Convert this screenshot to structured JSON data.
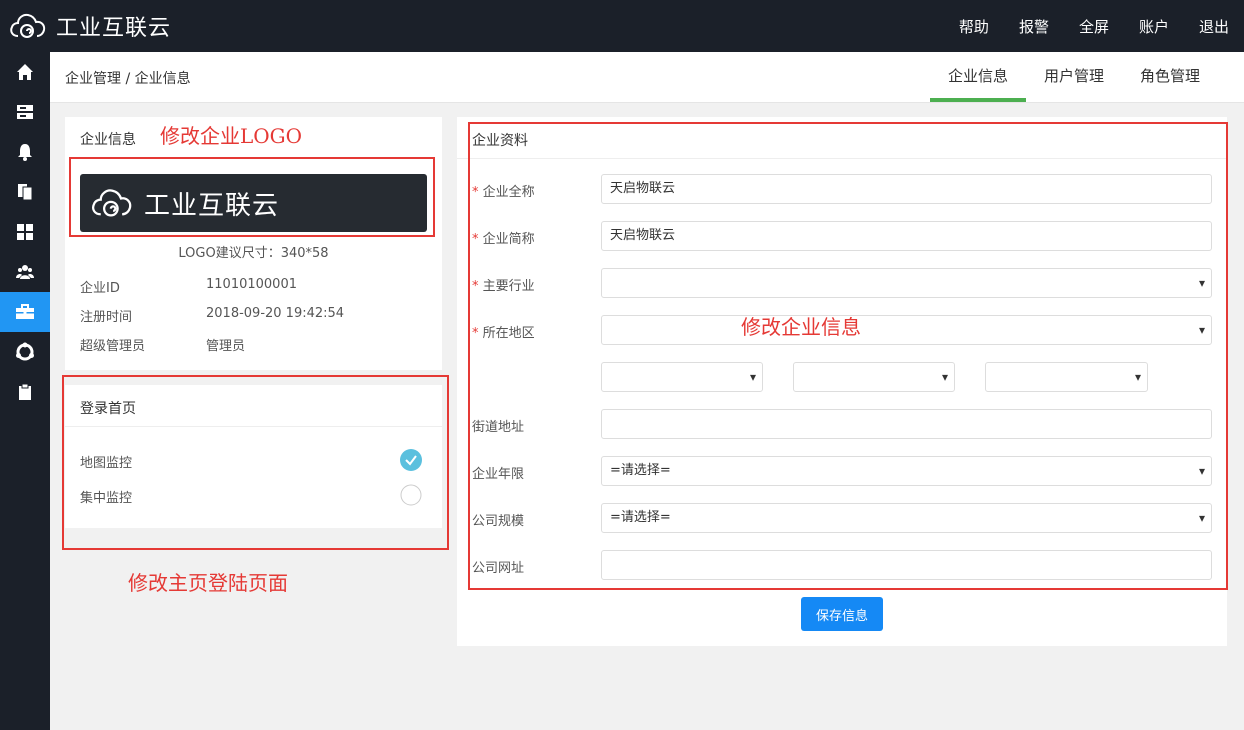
{
  "app": {
    "title": "工业互联云"
  },
  "topnav": [
    {
      "label": "帮助"
    },
    {
      "label": "报警"
    },
    {
      "label": "全屏"
    },
    {
      "label": "账户"
    },
    {
      "label": "退出"
    }
  ],
  "sidebar": [
    {
      "icon": "home-icon"
    },
    {
      "icon": "server-icon"
    },
    {
      "icon": "bell-icon"
    },
    {
      "icon": "copy-icon"
    },
    {
      "icon": "grid-icon"
    },
    {
      "icon": "users-icon"
    },
    {
      "icon": "briefcase-icon",
      "active": true
    },
    {
      "icon": "shield-icon"
    },
    {
      "icon": "clipboard-icon"
    }
  ],
  "breadcrumb": "企业管理 / 企业信息",
  "tabs": [
    {
      "label": "企业信息",
      "active": true
    },
    {
      "label": "用户管理"
    },
    {
      "label": "角色管理"
    }
  ],
  "company_card": {
    "title": "企业信息",
    "logo_text": "工业互联云",
    "logo_hint": "LOGO建议尺寸：340*58",
    "rows": [
      {
        "label": "企业ID",
        "value": "11010100001"
      },
      {
        "label": "注册时间",
        "value": "2018-09-20 19:42:54"
      },
      {
        "label": "超级管理员",
        "value": "管理员"
      }
    ]
  },
  "login_card": {
    "title": "登录首页",
    "options": [
      {
        "label": "地图监控",
        "checked": true
      },
      {
        "label": "集中监控",
        "checked": false
      }
    ]
  },
  "form": {
    "title": "企业资料",
    "full_name": {
      "label": "企业全称",
      "value": "天启物联云"
    },
    "short_name": {
      "label": "企业简称",
      "value": "天启物联云"
    },
    "industry": {
      "label": "主要行业",
      "value": ""
    },
    "region": {
      "label": "所在地区",
      "value": ""
    },
    "street": {
      "label": "街道地址",
      "value": ""
    },
    "years": {
      "label": "企业年限",
      "value": "=请选择="
    },
    "scale": {
      "label": "公司规模",
      "value": "=请选择="
    },
    "website": {
      "label": "公司网址",
      "value": ""
    },
    "save_label": "保存信息"
  },
  "annotations": {
    "logo": "修改企业LOGO",
    "info": "修改企业信息",
    "login": "修改主页登陆页面"
  },
  "colors": {
    "accent": "#2196f3",
    "tab_active": "#4caf50",
    "annotation": "#e53935",
    "dark": "#1b2029"
  }
}
